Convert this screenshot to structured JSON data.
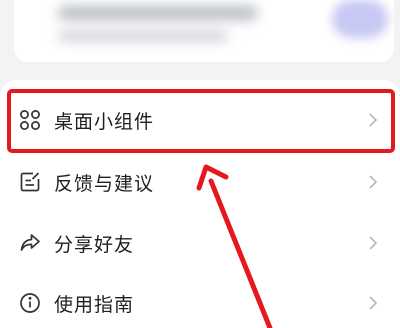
{
  "menu": {
    "items": [
      {
        "label": "桌面小组件",
        "icon": "widgets-grid-icon"
      },
      {
        "label": "反馈与建议",
        "icon": "feedback-edit-icon"
      },
      {
        "label": "分享好友",
        "icon": "share-arrow-icon"
      },
      {
        "label": "使用指南",
        "icon": "info-icon"
      }
    ]
  },
  "annotation": {
    "highlight_color": "#e5181f",
    "target": "桌面小组件"
  },
  "colors": {
    "background": "#f3f3f5",
    "card": "#ffffff",
    "text": "#1f1f1f",
    "chevron": "#b8b8b8"
  }
}
